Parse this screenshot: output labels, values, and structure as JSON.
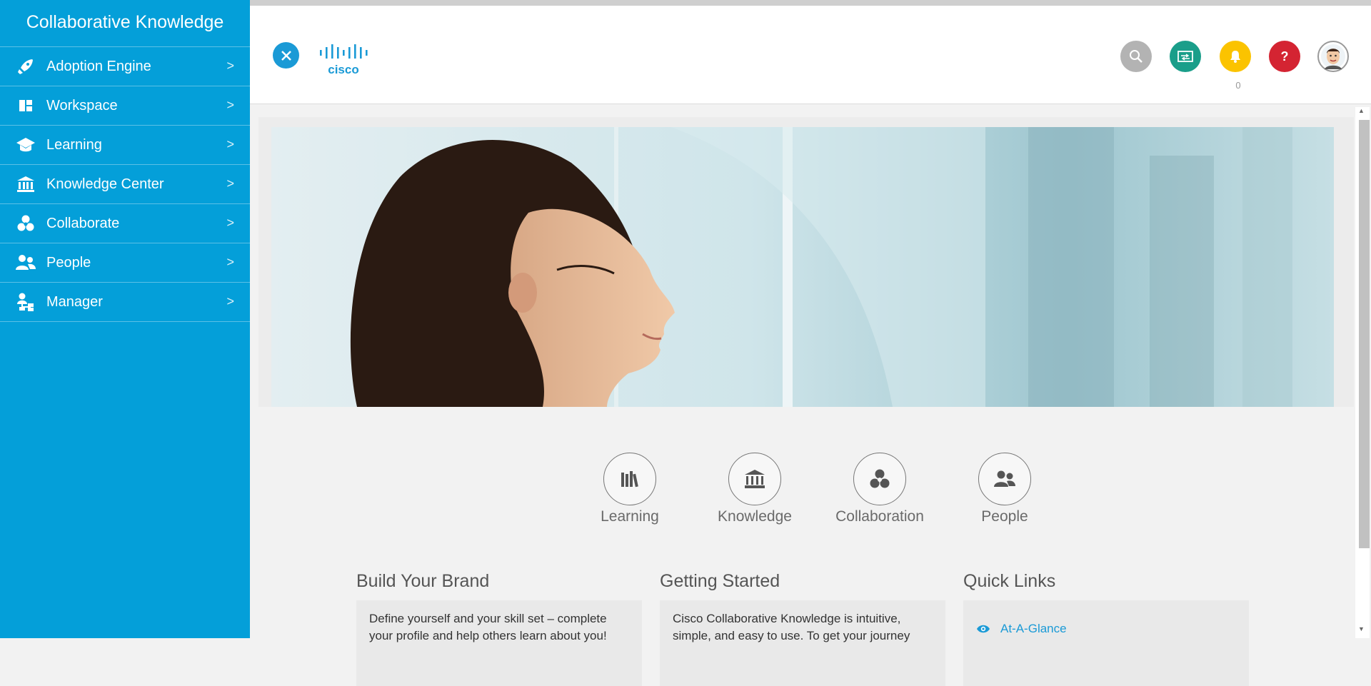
{
  "sidebar": {
    "title": "Collaborative Knowledge",
    "items": [
      {
        "label": "Adoption Engine",
        "icon": "rocket-icon"
      },
      {
        "label": "Workspace",
        "icon": "workspace-icon"
      },
      {
        "label": "Learning",
        "icon": "graduation-cap-icon"
      },
      {
        "label": "Knowledge Center",
        "icon": "bank-icon"
      },
      {
        "label": "Collaborate",
        "icon": "collaborate-icon"
      },
      {
        "label": "People",
        "icon": "people-icon"
      },
      {
        "label": "Manager",
        "icon": "org-chart-icon"
      }
    ]
  },
  "header": {
    "brand": "cisco",
    "notification_count": "0",
    "colors": {
      "search": "#b3b3b3",
      "switch": "#1a9e8a",
      "bell": "#fbc300",
      "help": "#d42432",
      "accent": "#049fd9"
    }
  },
  "features": [
    {
      "label": "Learning",
      "icon": "books-icon"
    },
    {
      "label": "Knowledge",
      "icon": "bank-icon"
    },
    {
      "label": "Collaboration",
      "icon": "collaborate-icon"
    },
    {
      "label": "People",
      "icon": "people-icon"
    }
  ],
  "sections": {
    "brand": {
      "title": "Build Your Brand",
      "text": "Define yourself and your skill set – complete your profile and help others learn about you!"
    },
    "getting_started": {
      "title": "Getting Started",
      "text": "Cisco Collaborative Knowledge is intuitive, simple, and easy to use. To get your journey"
    },
    "quick_links": {
      "title": "Quick Links",
      "links": [
        "At-A-Glance"
      ]
    }
  }
}
